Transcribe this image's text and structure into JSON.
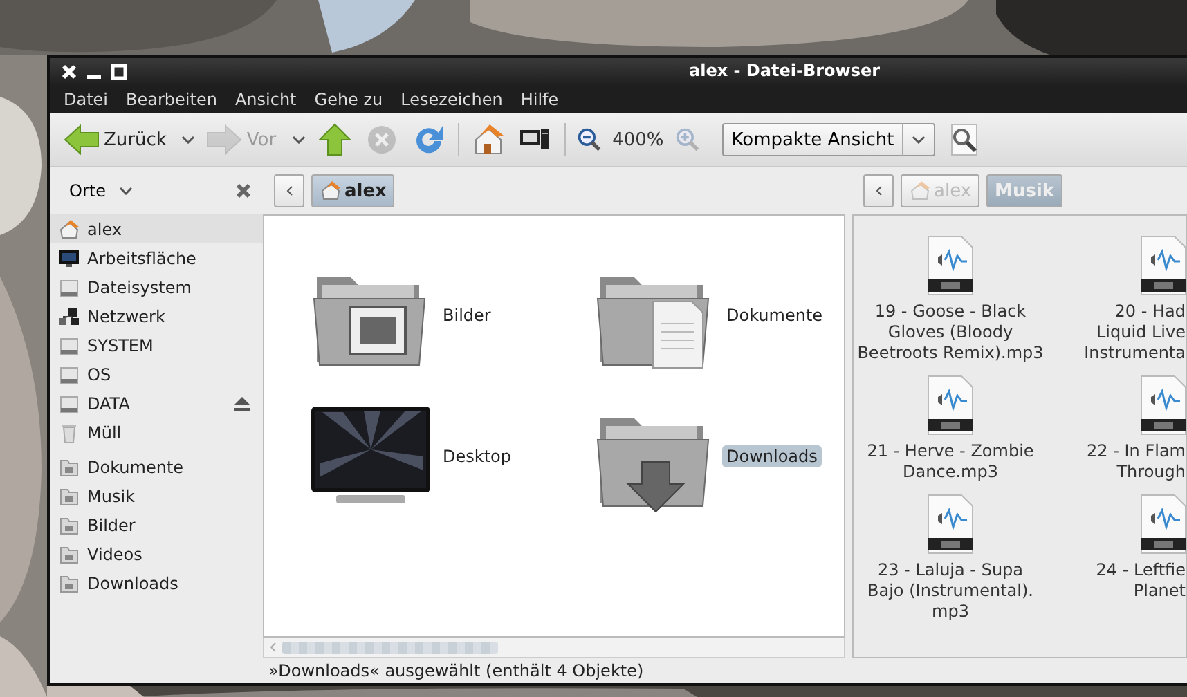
{
  "window": {
    "title": "alex - Datei-Browser"
  },
  "menu": [
    "Datei",
    "Bearbeiten",
    "Ansicht",
    "Gehe zu",
    "Lesezeichen",
    "Hilfe"
  ],
  "toolbar": [
    {
      "kind": "back",
      "label": "Zurück",
      "disabled": false
    },
    {
      "kind": "forward",
      "label": "Vor",
      "disabled": true
    },
    {
      "kind": "up",
      "disabled": false
    },
    {
      "kind": "stop",
      "disabled": true
    },
    {
      "kind": "reload",
      "disabled": false
    },
    {
      "kind": "separator"
    },
    {
      "kind": "home",
      "disabled": false
    },
    {
      "kind": "computer",
      "disabled": false
    },
    {
      "kind": "separator"
    },
    {
      "kind": "zoom-out",
      "disabled": false
    },
    {
      "kind": "zoom-level",
      "label": "400%"
    },
    {
      "kind": "zoom-in",
      "disabled": true
    },
    {
      "kind": "view-select",
      "label": "Kompakte Ansicht"
    },
    {
      "kind": "search",
      "disabled": false
    }
  ],
  "sidebar": {
    "header": "Orte",
    "items": [
      {
        "label": "alex",
        "kind": "home",
        "selected": true,
        "ejectable": false
      },
      {
        "label": "Arbeitsfläche",
        "kind": "desktop",
        "selected": false,
        "ejectable": false
      },
      {
        "label": "Dateisystem",
        "kind": "drive",
        "selected": false,
        "ejectable": false
      },
      {
        "label": "Netzwerk",
        "kind": "network",
        "selected": false,
        "ejectable": false
      },
      {
        "label": "SYSTEM",
        "kind": "drive",
        "selected": false,
        "ejectable": false
      },
      {
        "label": "OS",
        "kind": "drive",
        "selected": false,
        "ejectable": false
      },
      {
        "label": "DATA",
        "kind": "drive",
        "selected": false,
        "ejectable": true
      },
      {
        "label": "Müll",
        "kind": "trash",
        "selected": false,
        "ejectable": false
      },
      {
        "kind": "gap"
      },
      {
        "label": "Dokumente",
        "kind": "folder",
        "selected": false,
        "ejectable": false
      },
      {
        "label": "Musik",
        "kind": "folder",
        "selected": false,
        "ejectable": false
      },
      {
        "label": "Bilder",
        "kind": "folder",
        "selected": false,
        "ejectable": false
      },
      {
        "label": "Videos",
        "kind": "folder",
        "selected": false,
        "ejectable": false
      },
      {
        "label": "Downloads",
        "kind": "folder",
        "selected": false,
        "ejectable": false
      }
    ]
  },
  "left_pane": {
    "active": true,
    "path": [
      {
        "label": "alex",
        "selected": true
      }
    ],
    "items": [
      {
        "label": "Bilder",
        "kind": "pictures",
        "selected": false
      },
      {
        "label": "Dokumente",
        "kind": "documents",
        "selected": false
      },
      {
        "label": "Desktop",
        "kind": "desktop",
        "selected": false
      },
      {
        "label": "Downloads",
        "kind": "downloads",
        "selected": true
      }
    ]
  },
  "right_pane": {
    "active": false,
    "path": [
      {
        "label": "alex",
        "selected": false
      },
      {
        "label": "Musik",
        "selected": true
      }
    ],
    "files": [
      {
        "lines": [
          "19 - Goose - Black",
          "Gloves (Bloody",
          "Beetroots Remix).mp3"
        ]
      },
      {
        "lines": [
          "20 - Had",
          "Liquid Live",
          "Instrumenta"
        ]
      },
      {
        "lines": [
          "21 - Herve - Zombie",
          "Dance.mp3"
        ]
      },
      {
        "lines": [
          "22 - In Flam",
          "Through"
        ]
      },
      {
        "lines": [
          "23 - Laluja - Supa",
          "Bajo (Instrumental).",
          "mp3"
        ]
      },
      {
        "lines": [
          "24 - Leftfie",
          "Planet"
        ]
      }
    ]
  },
  "status_bar": "»Downloads« ausgewählt (enthält 4 Objekte)"
}
